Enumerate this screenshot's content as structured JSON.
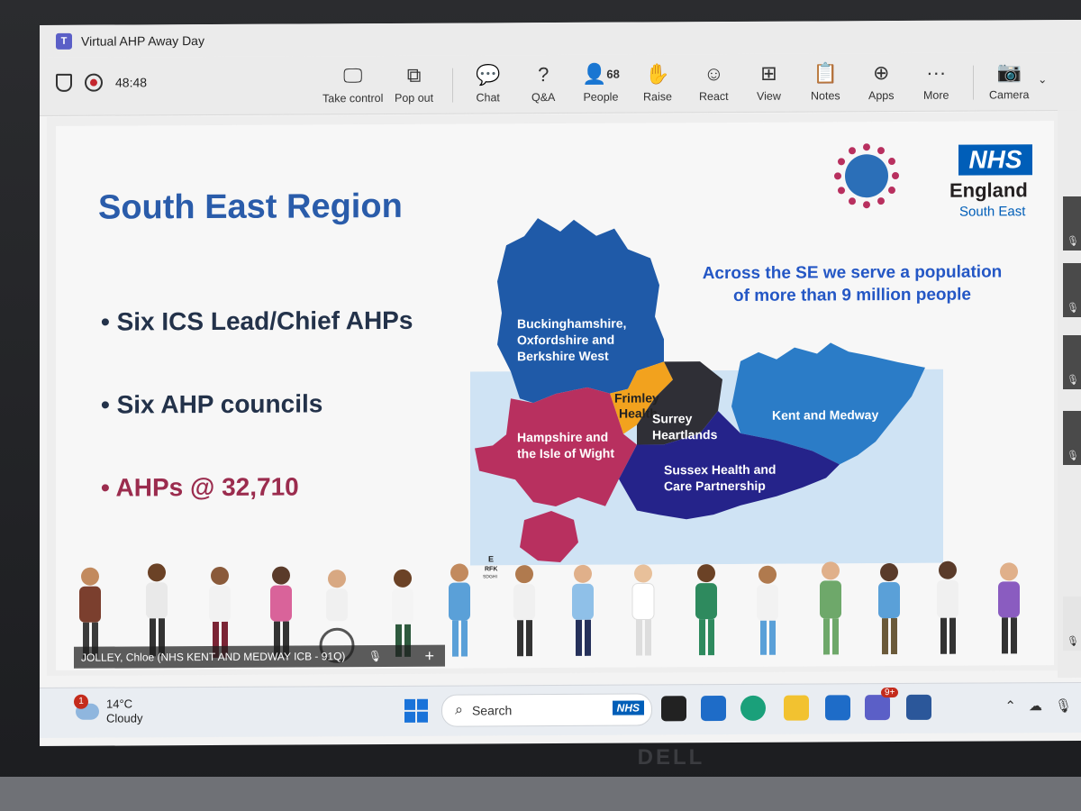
{
  "window": {
    "title": "Virtual AHP Away Day"
  },
  "toolbar": {
    "timer": "48:48",
    "buttons": [
      {
        "id": "take-control",
        "label": "Take control",
        "icon": "take-control-icon"
      },
      {
        "id": "pop-out",
        "label": "Pop out",
        "icon": "pop-out-icon"
      },
      {
        "id": "chat",
        "label": "Chat",
        "icon": "chat-icon"
      },
      {
        "id": "qa",
        "label": "Q&A",
        "icon": "qa-icon"
      },
      {
        "id": "people",
        "label": "People",
        "icon": "people-icon",
        "count": "68"
      },
      {
        "id": "raise",
        "label": "Raise",
        "icon": "raise-hand-icon"
      },
      {
        "id": "react",
        "label": "React",
        "icon": "react-icon"
      },
      {
        "id": "view",
        "label": "View",
        "icon": "view-icon"
      },
      {
        "id": "notes",
        "label": "Notes",
        "icon": "notes-icon"
      },
      {
        "id": "apps",
        "label": "Apps",
        "icon": "apps-icon"
      },
      {
        "id": "more",
        "label": "More",
        "icon": "more-icon"
      },
      {
        "id": "camera",
        "label": "Camera",
        "icon": "camera-off-icon"
      }
    ]
  },
  "slide": {
    "title": "South East Region",
    "bullets": [
      "Six ICS Lead/Chief AHPs",
      "Six AHP councils",
      "AHPs @ 32,710"
    ],
    "callout": "Across the SE we serve a population of more than 9 million people",
    "logo": {
      "nhs": "NHS",
      "line1": "England",
      "line2": "South East"
    },
    "regions": [
      {
        "name": "Buckinghamshire, Oxfordshire and Berkshire West",
        "lines": [
          "Buckinghamshire,",
          "Oxfordshire and",
          "Berkshire West"
        ],
        "color": "#1f5aa8"
      },
      {
        "name": "Frimley Health",
        "lines": [
          "Frimley",
          "Health"
        ],
        "color": "#f2a21e"
      },
      {
        "name": "Surrey Heartlands",
        "lines": [
          "Surrey",
          "Heartlands"
        ],
        "color": "#2f2f36"
      },
      {
        "name": "Kent and Medway",
        "lines": [
          "Kent and Medway"
        ],
        "color": "#2b7cc7"
      },
      {
        "name": "Hampshire and the Isle of Wight",
        "lines": [
          "Hampshire and",
          "the Isle of Wight"
        ],
        "color": "#b8305f"
      },
      {
        "name": "Sussex Health and Care Partnership",
        "lines": [
          "Sussex Health and",
          "Care Partnership"
        ],
        "color": "#25238a"
      }
    ],
    "eye_chart": [
      "E",
      "RFK",
      "SDGHI"
    ]
  },
  "participant": {
    "name": "JOLLEY, Chloe (NHS KENT AND MEDWAY ICB - 91Q)"
  },
  "taskbar": {
    "weather": {
      "temp": "14°C",
      "condition": "Cloudy",
      "badge": "1"
    },
    "search_placeholder": "Search",
    "search_badge": "NHS",
    "teams_badge": "9+",
    "brand": "DELL"
  },
  "colors": {
    "nhs_blue": "#005eb8",
    "title_blue": "#2a5caa",
    "bullet_accent": "#9b2c4e",
    "callout_blue": "#2457c5"
  }
}
